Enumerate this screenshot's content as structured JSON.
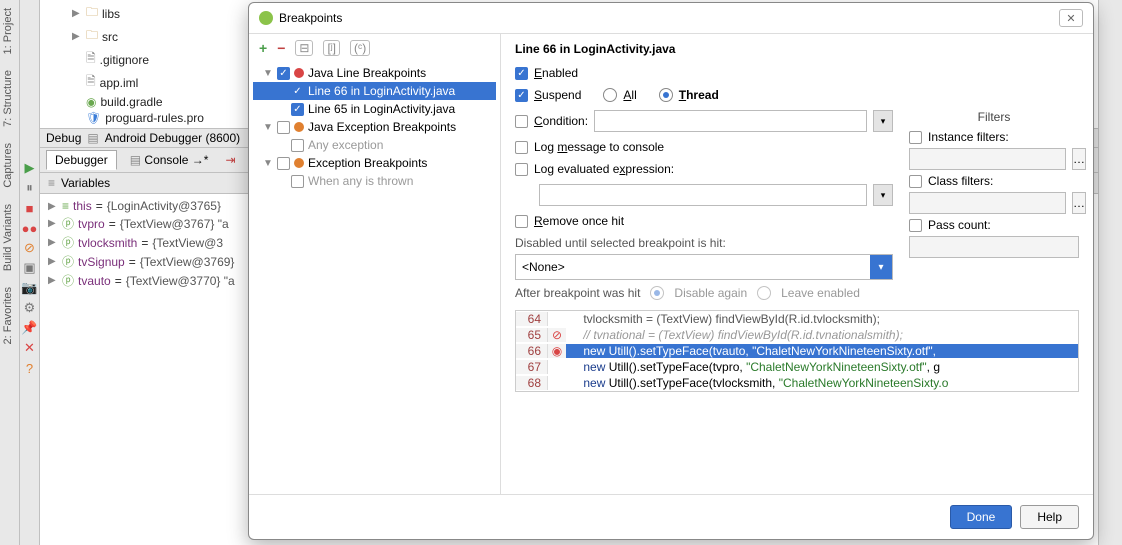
{
  "sidebar": {
    "tabs": [
      "1: Project",
      "7: Structure",
      "Captures",
      "Build Variants",
      "2: Favorites"
    ]
  },
  "tree": {
    "items": [
      {
        "icon": "folder",
        "label": "libs",
        "indent": 1,
        "arrow": "▶"
      },
      {
        "icon": "folder",
        "label": "src",
        "indent": 1,
        "arrow": "▶"
      },
      {
        "icon": "file",
        "label": ".gitignore",
        "indent": 1
      },
      {
        "icon": "file",
        "label": "app.iml",
        "indent": 1
      },
      {
        "icon": "gear",
        "label": "build.gradle",
        "indent": 1
      },
      {
        "icon": "proguard",
        "label": "proguard-rules.pro",
        "indent": 1
      }
    ]
  },
  "debug": {
    "title": "Debug",
    "session": "Android Debugger (8600)",
    "tabs": {
      "debugger": "Debugger",
      "console": "Console"
    },
    "vars_header": "Variables",
    "vars": [
      {
        "name": "this",
        "val": "{LoginActivity@3765}",
        "arrow": true,
        "ic": "≡"
      },
      {
        "name": "tvpro",
        "val": "{TextView@3767} \"a",
        "arrow": true,
        "ic": "ⓟ"
      },
      {
        "name": "tvlocksmith",
        "val": "{TextView@3",
        "arrow": true,
        "ic": "ⓟ"
      },
      {
        "name": "tvSignup",
        "val": "{TextView@3769}",
        "arrow": true,
        "ic": "ⓟ"
      },
      {
        "name": "tvauto",
        "val": "{TextView@3770} \"a",
        "arrow": true,
        "ic": "ⓟ"
      }
    ]
  },
  "dialog": {
    "title": "Breakpoints",
    "tree": {
      "java_line": "Java Line Breakpoints",
      "bp1": "Line 66 in LoginActivity.java",
      "bp2": "Line 65 in LoginActivity.java",
      "java_exc": "Java Exception Breakpoints",
      "any_exc": "Any exception",
      "exc_bp": "Exception Breakpoints",
      "when_any": "When any is thrown"
    },
    "right": {
      "heading": "Line 66 in LoginActivity.java",
      "enabled": "Enabled",
      "suspend": "Suspend",
      "all": "All",
      "thread": "Thread",
      "condition": "Condition:",
      "logmsg": "Log message to console",
      "logexpr": "Log evaluated expression:",
      "removeonce": "Remove once hit",
      "disabled_until": "Disabled until selected breakpoint is hit:",
      "none": "<None>",
      "after_hit": "After breakpoint was hit",
      "disable_again": "Disable again",
      "leave_enabled": "Leave enabled",
      "filters": "Filters",
      "instance": "Instance filters:",
      "class": "Class filters:",
      "pass": "Pass count:"
    },
    "code": {
      "l64": {
        "n": "64",
        "txt": "tvlocksmith = (TextView) findViewById(R.id.tvlocksmith);"
      },
      "l65": {
        "n": "65",
        "txt": "// tvnational = (TextView) findViewById(R.id.tvnationalsmith);"
      },
      "l66": {
        "n": "66",
        "txt": "new Utill().setTypeFace(tvauto, \"ChaletNewYorkNineteenSixty.otf\","
      },
      "l67": {
        "n": "67",
        "txt": "new Utill().setTypeFace(tvpro, \"ChaletNewYorkNineteenSixty.otf\", g"
      },
      "l68": {
        "n": "68",
        "txt": "new Utill().setTypeFace(tvlocksmith, \"ChaletNewYorkNineteenSixty.o"
      }
    },
    "buttons": {
      "done": "Done",
      "help": "Help"
    }
  }
}
